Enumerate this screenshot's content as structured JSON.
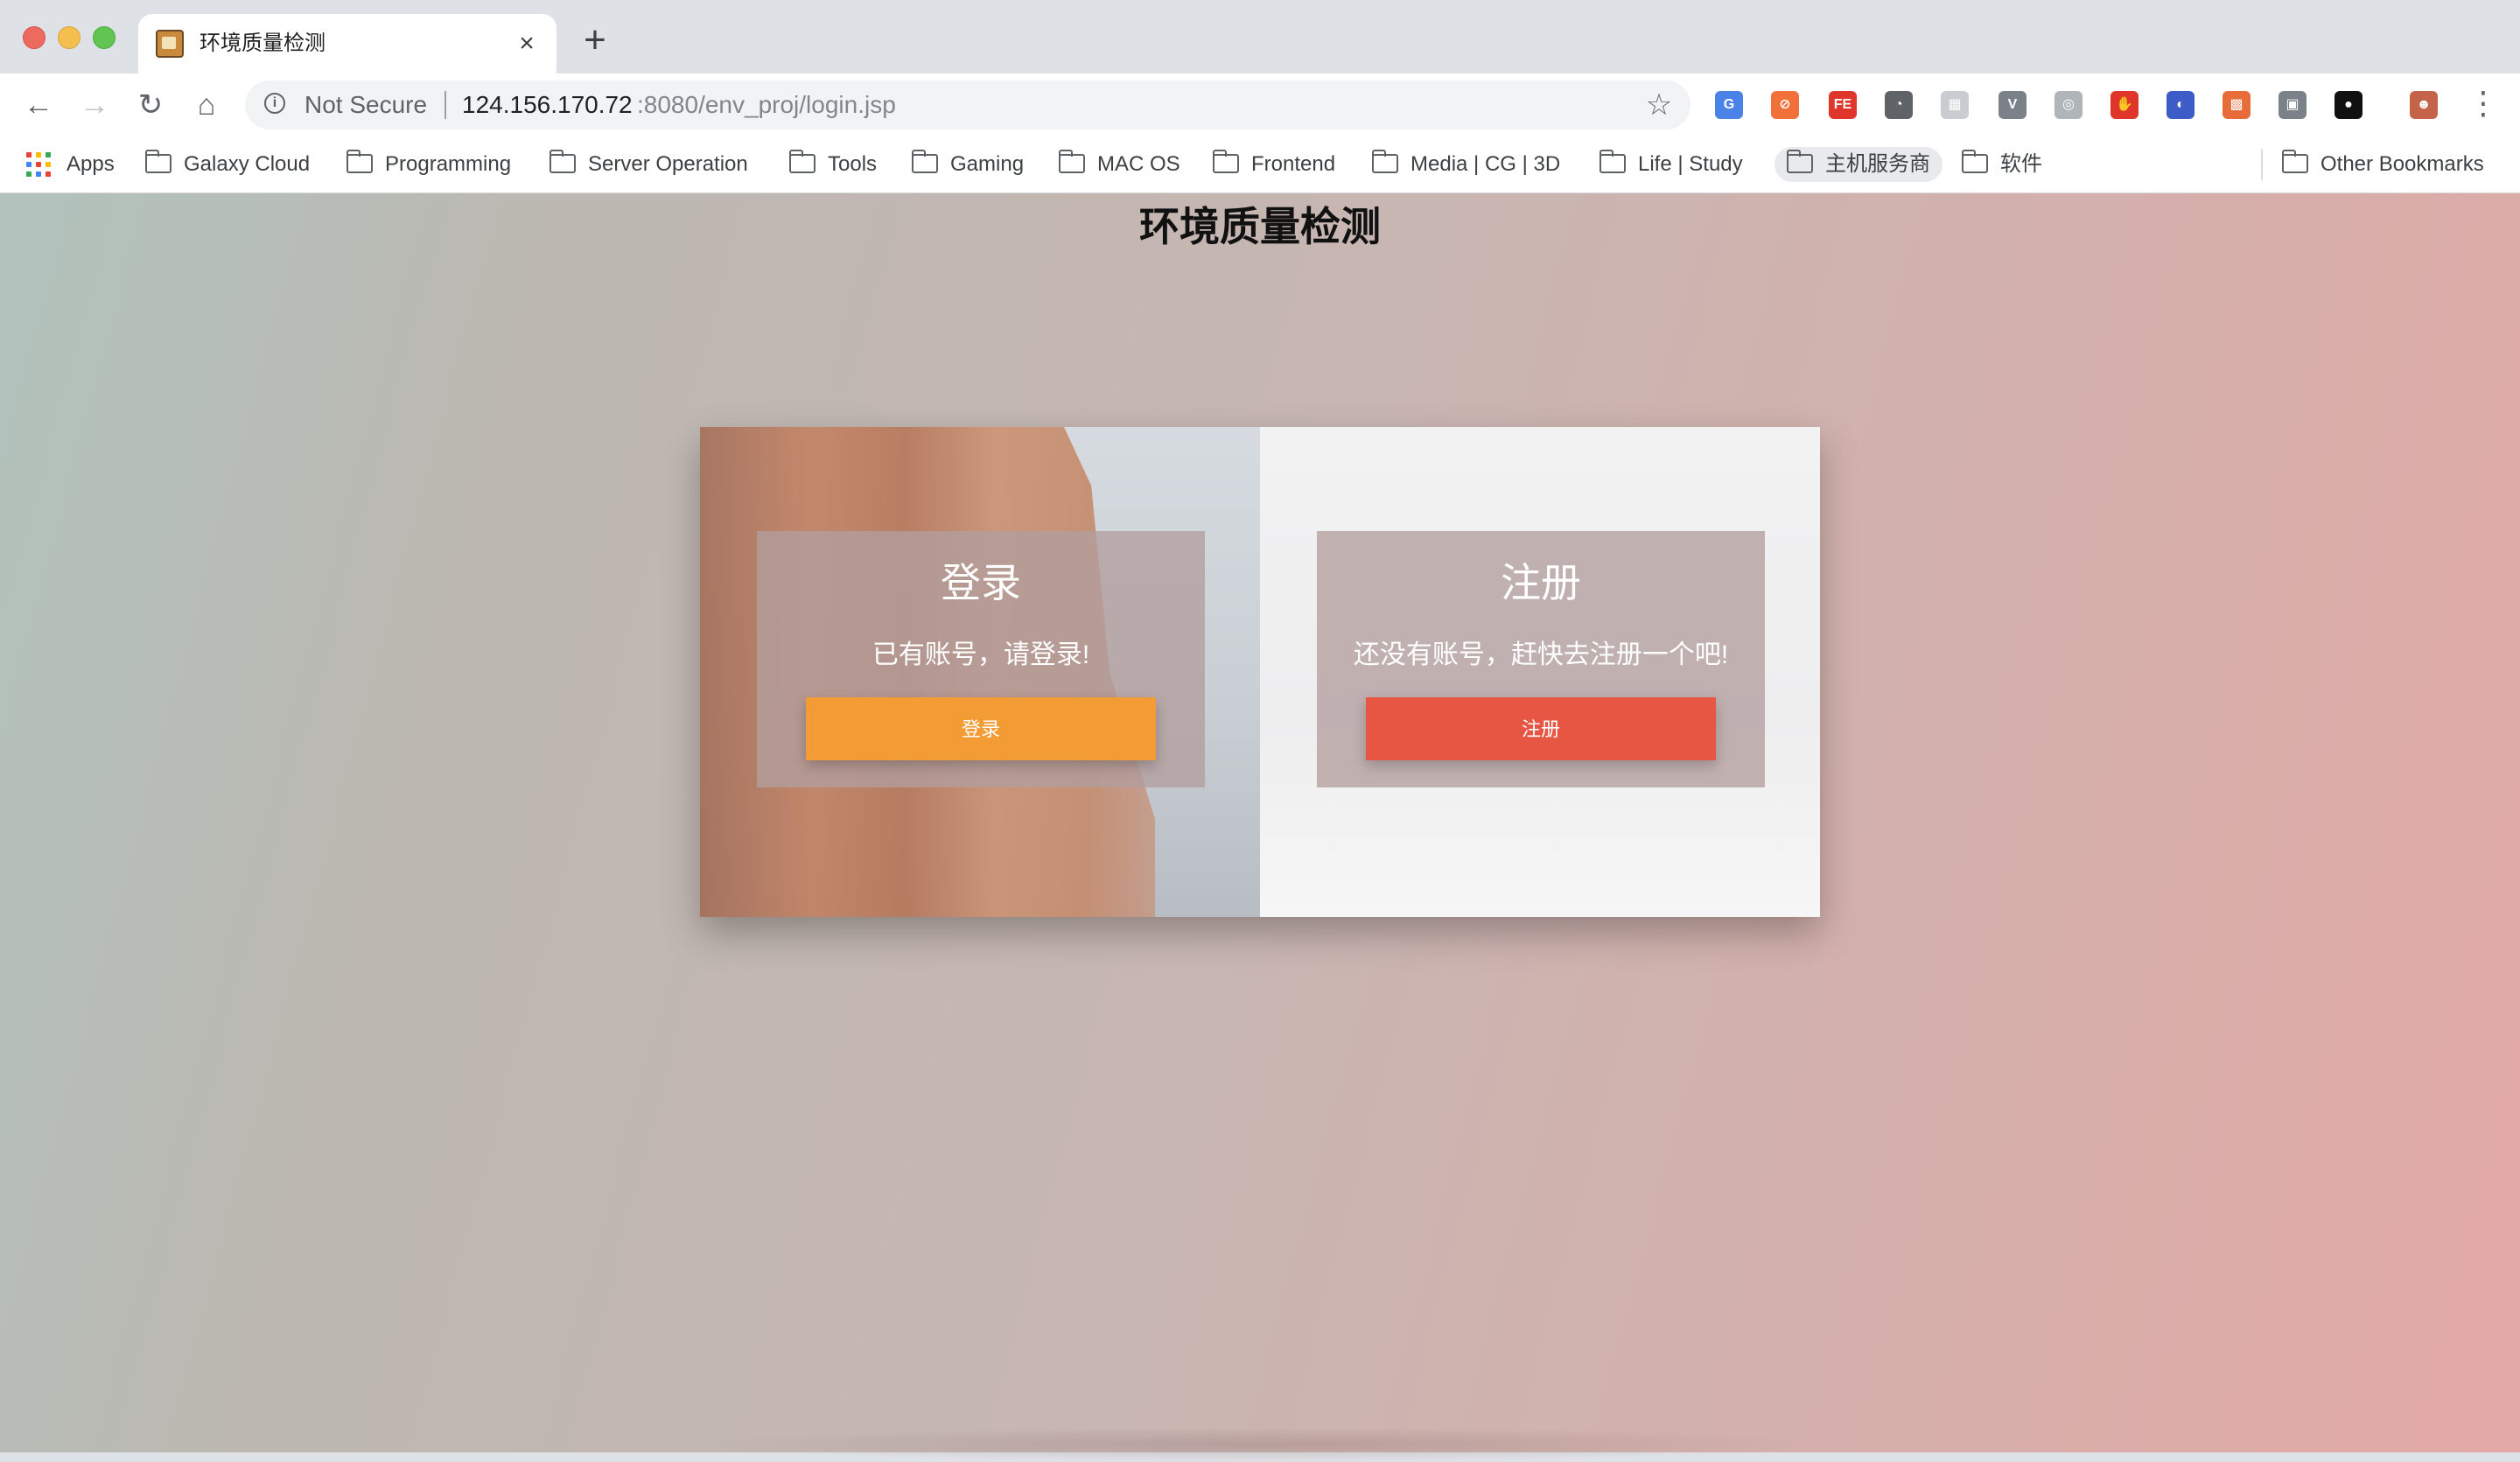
{
  "browser": {
    "tab_title": "环境质量检测",
    "tab_close": "×",
    "new_tab": "+",
    "nav": {
      "back": "←",
      "forward": "→",
      "reload": "↻",
      "home": "⌂"
    },
    "address": {
      "security": "Not Secure",
      "host": "124.156.170.72",
      "path": ":8080/env_proj/login.jsp"
    },
    "star": "☆",
    "menu": "⋮",
    "extensions": [
      {
        "name": "google-translate-icon",
        "label": "G",
        "color": "#4a82e8"
      },
      {
        "name": "orange-circle-extension-icon",
        "label": "⊘",
        "color": "#f2703a"
      },
      {
        "name": "fe-helper-extension-icon",
        "label": "FE",
        "color": "#e0352b"
      },
      {
        "name": "speedometer-extension-icon",
        "label": "◔",
        "color": "#5f6368"
      },
      {
        "name": "grid-extension-icon",
        "label": "▦",
        "color": "#c9cdd2"
      },
      {
        "name": "vue-devtools-icon",
        "label": "V",
        "color": "#7b8188"
      },
      {
        "name": "circle-target-extension-icon",
        "label": "◎",
        "color": "#b0b5ba"
      },
      {
        "name": "adblock-hand-icon",
        "label": "✋",
        "color": "#e0352b"
      },
      {
        "name": "colorful-circle-extension-icon",
        "label": "◐",
        "color": "#3d5cc8"
      },
      {
        "name": "color-grid-extension-icon",
        "label": "▩",
        "color": "#e86b3a"
      },
      {
        "name": "gray-rect-extension-icon",
        "label": "▣",
        "color": "#7b8188"
      },
      {
        "name": "black-ring-extension-icon",
        "label": "●",
        "color": "#111111"
      },
      {
        "name": "profile-avatar-icon",
        "label": "☻",
        "color": "#c4624a"
      }
    ],
    "bookmarks": {
      "apps": "Apps",
      "folders": [
        "Galaxy Cloud",
        "Programming",
        "Server Operation",
        "Tools",
        "Gaming",
        "MAC OS",
        "Frontend",
        "Media | CG | 3D",
        "Life | Study",
        "主机服务商",
        "软件"
      ],
      "other": "Other Bookmarks"
    }
  },
  "page": {
    "title": "环境质量检测",
    "login": {
      "title": "登录",
      "desc": "已有账号，请登录!",
      "button": "登录"
    },
    "register": {
      "title": "注册",
      "desc": "还没有账号，赶快去注册一个吧!",
      "button": "注册"
    }
  }
}
